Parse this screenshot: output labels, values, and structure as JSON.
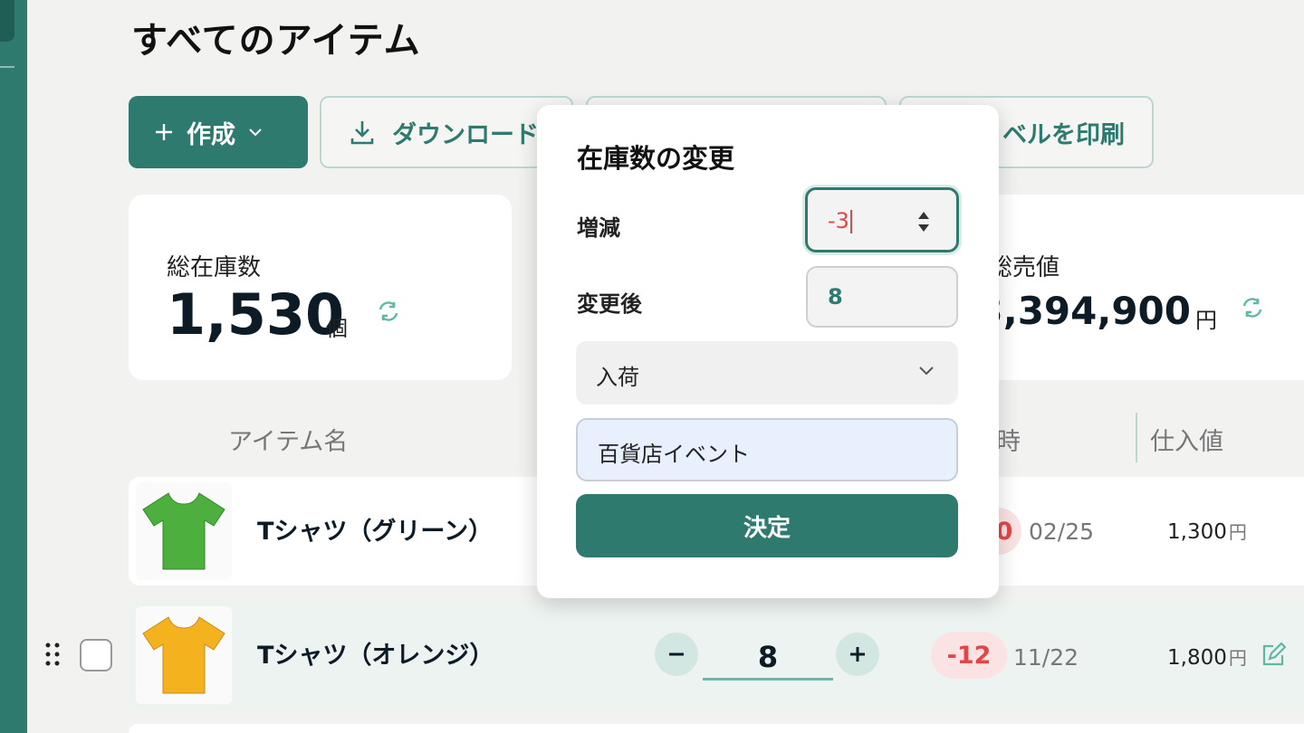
{
  "page": {
    "title": "すべてのアイテム"
  },
  "toolbar": {
    "create_label": "作成",
    "download_label": "ダウンロード",
    "print_label": "ベルを印刷"
  },
  "summary": {
    "left": {
      "label": "総在庫数",
      "value": "1,530",
      "unit": "個"
    },
    "right": {
      "label": "総売値",
      "value": "23,394,900",
      "unit": "円"
    }
  },
  "table": {
    "headers": {
      "name": "アイテム名",
      "time": "時",
      "cost": "仕入値"
    },
    "rows": [
      {
        "name": "Tシャツ（グリーン）",
        "badge": "0",
        "date": "02/25",
        "price": "1,300",
        "yen": "円",
        "shirt_color": "#4caf3e"
      },
      {
        "name": "Tシャツ（オレンジ）",
        "quantity": "8",
        "badge": "-12",
        "date": "11/22",
        "price": "1,800",
        "yen": "円",
        "shirt_color": "#f4b21f"
      }
    ]
  },
  "popover": {
    "title": "在庫数の変更",
    "delta_label": "増減",
    "delta_value": "-3",
    "after_label": "変更後",
    "after_value": "8",
    "reason_value": "入荷",
    "memo_value": "百貨店イベント",
    "submit_label": "決定"
  },
  "colors": {
    "brand": "#2f7a6f",
    "negative": "#e04848"
  }
}
